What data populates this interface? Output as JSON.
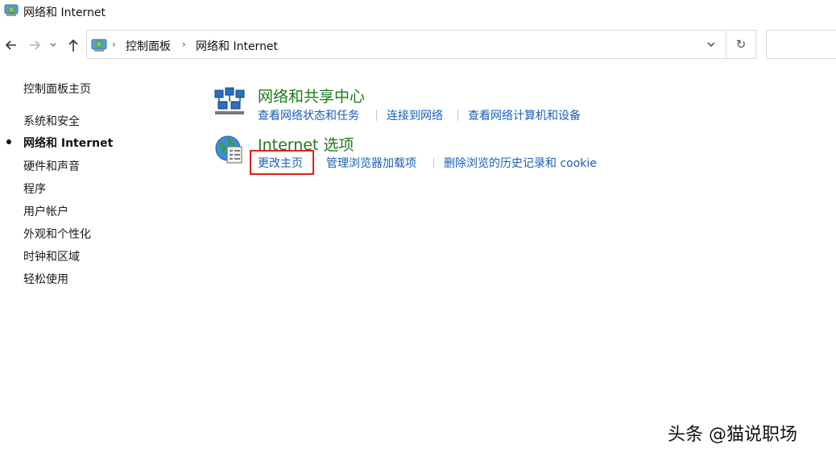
{
  "window": {
    "title": "网络和 Internet",
    "icon": "network-folder-icon"
  },
  "navigation": {
    "back_icon": "back-arrow-icon",
    "forward_icon": "forward-arrow-icon",
    "recent_icon": "chevron-down-icon",
    "up_icon": "up-arrow-icon"
  },
  "address_bar": {
    "icon": "control-panel-icon",
    "breadcrumbs": [
      "控制面板",
      "网络和 Internet"
    ],
    "separator": "›",
    "dropdown_icon": "chevron-down-icon",
    "refresh_glyph": "↻"
  },
  "search": {
    "placeholder": ""
  },
  "sidebar": {
    "items": [
      {
        "label": "控制面板主页",
        "active": false
      },
      {
        "label": "系统和安全",
        "active": false
      },
      {
        "label": "网络和 Internet",
        "active": true
      },
      {
        "label": "硬件和声音",
        "active": false
      },
      {
        "label": "程序",
        "active": false
      },
      {
        "label": "用户帐户",
        "active": false
      },
      {
        "label": "外观和个性化",
        "active": false
      },
      {
        "label": "时钟和区域",
        "active": false
      },
      {
        "label": "轻松使用",
        "active": false
      }
    ]
  },
  "main": {
    "sections": [
      {
        "title": "网络和共享中心",
        "icon": "network-sharing-center-icon",
        "tasks": [
          "查看网络状态和任务",
          "连接到网络",
          "查看网络计算机和设备"
        ]
      },
      {
        "title": "Internet 选项",
        "icon": "internet-options-globe-icon",
        "tasks": [
          "更改主页",
          "管理浏览器加载项",
          "删除浏览的历史记录和 cookie"
        ],
        "highlighted_task": "更改主页"
      }
    ]
  },
  "watermark": "头条 @猫说职场",
  "colors": {
    "section_title": "#1e7a1e",
    "task_link": "#1a5fb4",
    "highlight_box": "#e0201a"
  }
}
